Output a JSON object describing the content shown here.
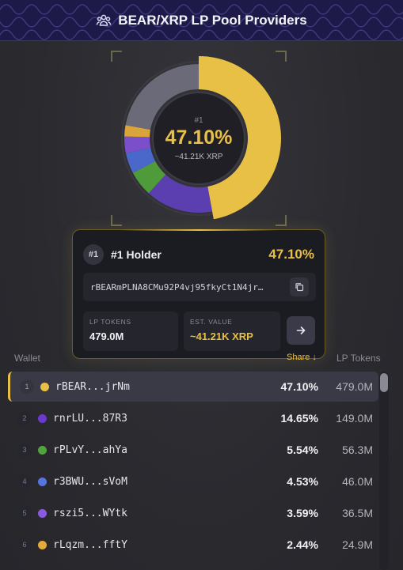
{
  "header": {
    "title": "BEAR/XRP LP Pool Providers",
    "icon": "users-icon"
  },
  "donut": {
    "rank": "#1",
    "pct": "47.10%",
    "xrp": "~41.21K XRP",
    "segments": [
      {
        "share": 47.1,
        "color": "#e9c046"
      },
      {
        "share": 14.65,
        "color": "#5b3fb0"
      },
      {
        "share": 5.54,
        "color": "#4f9a3a"
      },
      {
        "share": 4.53,
        "color": "#4a68c9"
      },
      {
        "share": 3.59,
        "color": "#7a4fc9"
      },
      {
        "share": 2.44,
        "color": "#d9a43a"
      },
      {
        "share": 22.15,
        "color": "#6a6a78"
      }
    ]
  },
  "card": {
    "rank_badge": "#1",
    "holder_label": "#1 Holder",
    "pct": "47.10%",
    "address": "rBEARmPLNA8CMu92P4vj95fkyCt1N4jr…",
    "lp_tokens_label": "LP TOKENS",
    "lp_tokens_value": "479.0M",
    "est_value_label": "EST. VALUE",
    "est_value_value": "~41.21K XRP"
  },
  "columns": {
    "wallet": "Wallet",
    "share": "Share ↓",
    "lp_tokens": "LP Tokens"
  },
  "rows": [
    {
      "num": "1",
      "addr": "rBEAR...jrNm",
      "pct": "47.10%",
      "lp": "479.0M",
      "color": "#e9c046"
    },
    {
      "num": "2",
      "addr": "rnrLU...87R3",
      "pct": "14.65%",
      "lp": "149.0M",
      "color": "#6a3ad0"
    },
    {
      "num": "3",
      "addr": "rPLvY...ahYa",
      "pct": "5.54%",
      "lp": "56.3M",
      "color": "#52a23d"
    },
    {
      "num": "4",
      "addr": "r3BWU...sVoM",
      "pct": "4.53%",
      "lp": "46.0M",
      "color": "#5575e0"
    },
    {
      "num": "5",
      "addr": "rszi5...WYtk",
      "pct": "3.59%",
      "lp": "36.5M",
      "color": "#8a5ae0"
    },
    {
      "num": "6",
      "addr": "rLqzm...fftY",
      "pct": "2.44%",
      "lp": "24.9M",
      "color": "#e3a93a"
    }
  ]
}
